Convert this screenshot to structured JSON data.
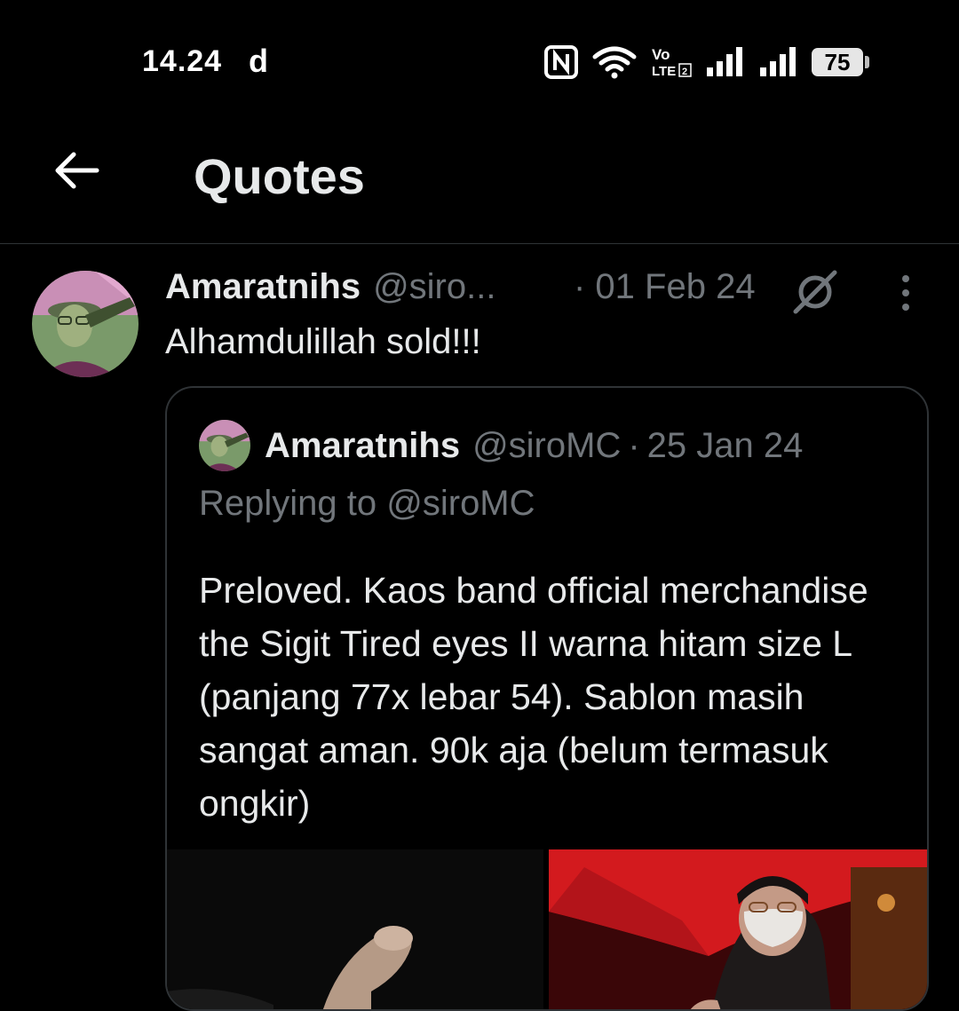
{
  "status_bar": {
    "time": "14.24",
    "carrier_glyph": "d",
    "battery": "75",
    "icons": [
      "nfc-icon",
      "wifi-icon",
      "volte-icon",
      "signal-icon",
      "signal-icon"
    ]
  },
  "header": {
    "title": "Quotes",
    "back_icon": "arrow-left-icon"
  },
  "tweet": {
    "name": "Amaratnihs",
    "handle": "@siro...",
    "date": "· 01 Feb 24",
    "text": "Alhamdulillah sold!!!",
    "quoted": {
      "name": "Amaratnihs",
      "handle": "@siroMC",
      "separator": "·",
      "date": "25 Jan 24",
      "replying_prefix": "Replying to",
      "replying_to": "@siroMC",
      "body": "Preloved. Kaos band official merchandise the Sigit Tired eyes II warna hitam size L (panjang 77x lebar 54). Sablon masih sangat aman. 90k aja (belum termasuk ongkir)"
    }
  },
  "colors": {
    "background": "#000000",
    "text_primary": "#e7e9ea",
    "text_secondary": "#71767b",
    "border": "#2f3336"
  }
}
